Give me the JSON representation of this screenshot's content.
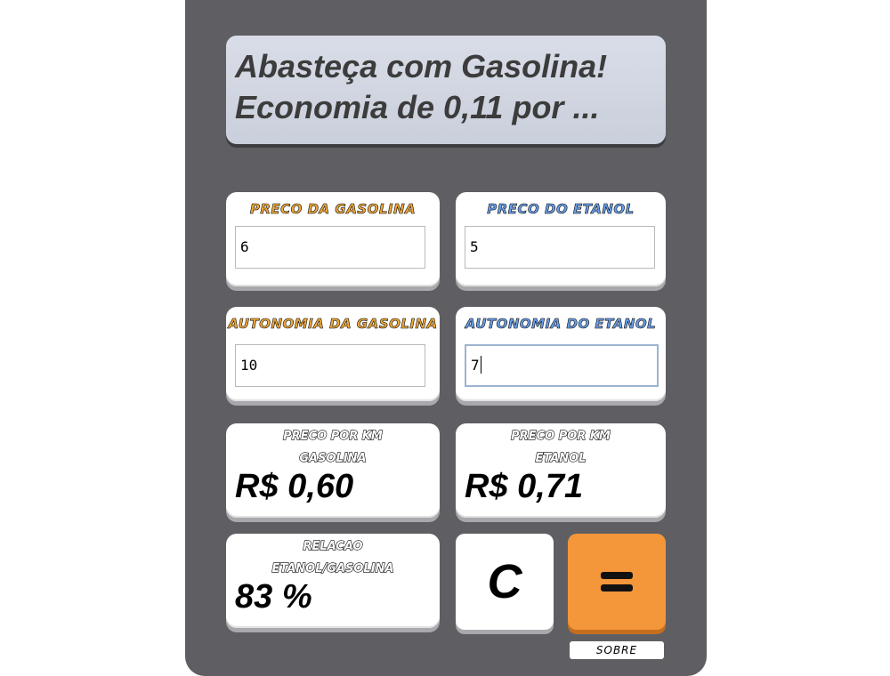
{
  "display": {
    "line1": "Abasteça com Gasolina!",
    "line2": "Economia de 0,11 por ..."
  },
  "inputs": {
    "preco_gasolina": {
      "label": "PRECO DA GASOLINA",
      "value": "6"
    },
    "preco_etanol": {
      "label": "PRECO DO ETANOL",
      "value": "5"
    },
    "autonomia_gasolina": {
      "label": "AUTONOMIA DA GASOLINA",
      "value": "10"
    },
    "autonomia_etanol": {
      "label": "AUTONOMIA DO ETANOL",
      "value": "7"
    }
  },
  "results": {
    "km_gasolina": {
      "label_line1": "PRECO POR KM",
      "label_line2": "GASOLINA",
      "value": "R$ 0,60"
    },
    "km_etanol": {
      "label_line1": "PRECO POR KM",
      "label_line2": "ETANOL",
      "value": "R$ 0,71"
    },
    "relacao": {
      "label_line1": "RELACAO",
      "label_line2": "ETANOL/GASOLINA",
      "value": "83 %"
    }
  },
  "buttons": {
    "clear_label": "C",
    "equals_icon": "equals-icon",
    "sobre_label": "SOBRE"
  },
  "colors": {
    "body": "#5f5f63",
    "gasolina_accent": "#f0a93a",
    "etanol_accent": "#6a9fe8",
    "equals_button": "#f4963a",
    "display_bg": "#d9dde8"
  }
}
